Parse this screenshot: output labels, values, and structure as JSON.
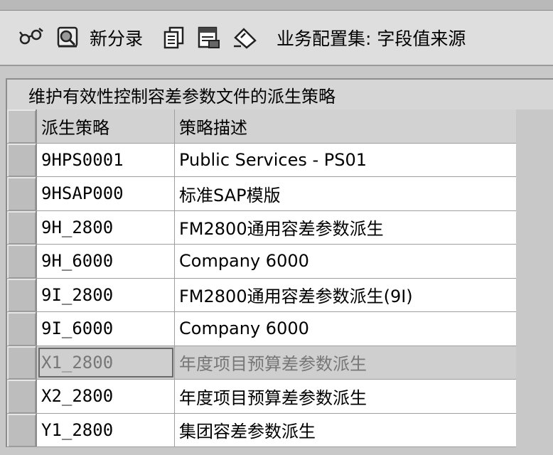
{
  "toolbar": {
    "icons": [
      "glasses-display-change-icon",
      "detail-view-icon",
      "copy-icon",
      "save-table-icon",
      "undo-change-icon"
    ],
    "new_entries_label": "新分录",
    "title": "业务配置集: 字段值来源"
  },
  "panel": {
    "title": "维护有效性控制容差参数文件的派生策略"
  },
  "table": {
    "columns": [
      "派生策略",
      "策略描述"
    ],
    "rows": [
      {
        "code": "9HPS0001",
        "desc": "Public Services - PS01"
      },
      {
        "code": "9HSAP000",
        "desc": "标准SAP模版"
      },
      {
        "code": "9H_2800",
        "desc": "FM2800通用容差参数派生"
      },
      {
        "code": "9H_6000",
        "desc": "Company 6000"
      },
      {
        "code": "9I_2800",
        "desc": "FM2800通用容差参数派生(9I)"
      },
      {
        "code": "9I_6000",
        "desc": "Company 6000"
      },
      {
        "code": "X1_2800",
        "desc": "年度项目预算差参数派生"
      },
      {
        "code": "X2_2800",
        "desc": "年度项目预算差参数派生"
      },
      {
        "code": "Y1_2800",
        "desc": "集团容差参数派生"
      }
    ],
    "selected_row_index": 6
  }
}
